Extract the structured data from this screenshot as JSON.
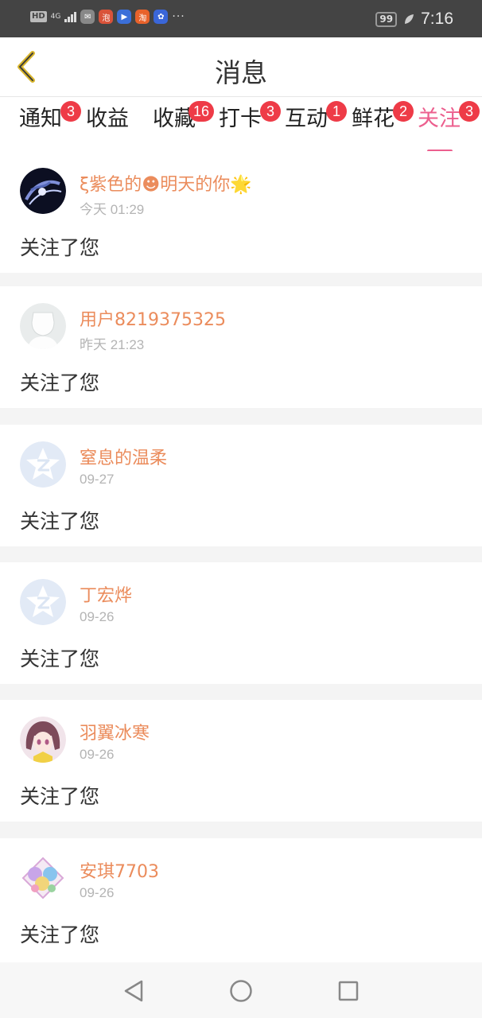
{
  "status_bar": {
    "hd_label": "HD",
    "network_label": "4G",
    "battery": "99",
    "time": "7:16",
    "app_icons": [
      {
        "name": "wechat-icon",
        "glyph": "✉",
        "color": "#888888"
      },
      {
        "name": "app-red-icon",
        "glyph": "泡",
        "color": "#d9533a"
      },
      {
        "name": "app-play-icon",
        "glyph": "▶",
        "color": "#3b6fd8"
      },
      {
        "name": "taobao-icon",
        "glyph": "淘",
        "color": "#e8622b"
      },
      {
        "name": "baidu-icon",
        "glyph": "✿",
        "color": "#3a66d8"
      }
    ],
    "more_indicator": "···"
  },
  "header": {
    "title": "消息"
  },
  "tabs": [
    {
      "label": "通知",
      "badge": "3"
    },
    {
      "label": "收益",
      "badge": ""
    },
    {
      "label": "收藏",
      "badge": "16"
    },
    {
      "label": "打卡",
      "badge": "3"
    },
    {
      "label": "互动",
      "badge": "1"
    },
    {
      "label": "鲜花",
      "badge": "2"
    },
    {
      "label": "关注",
      "badge": "3",
      "active": true
    }
  ],
  "messages": [
    {
      "name": "ξ紫色的☻明天的你🌟",
      "time": "今天 01:29",
      "text": "关注了您",
      "avatar": "dark-swirl"
    },
    {
      "name": "用户8219375325",
      "time": "昨天 21:23",
      "text": "关注了您",
      "avatar": "default-blank"
    },
    {
      "name": "窒息的温柔",
      "time": "09-27",
      "text": "关注了您",
      "avatar": "qq-logo"
    },
    {
      "name": "丁宏烨",
      "time": "09-26",
      "text": "关注了您",
      "avatar": "qq-logo"
    },
    {
      "name": "羽翼冰寒",
      "time": "09-26",
      "text": "关注了您",
      "avatar": "anime-girl"
    },
    {
      "name": "安琪7703",
      "time": "09-26",
      "text": "关注了您",
      "avatar": "anime-group"
    }
  ],
  "colors": {
    "accent": "#ec5f8e",
    "name": "#eb8c5c",
    "badge": "#ee3b47",
    "back_arrow": "#d8b52c"
  }
}
